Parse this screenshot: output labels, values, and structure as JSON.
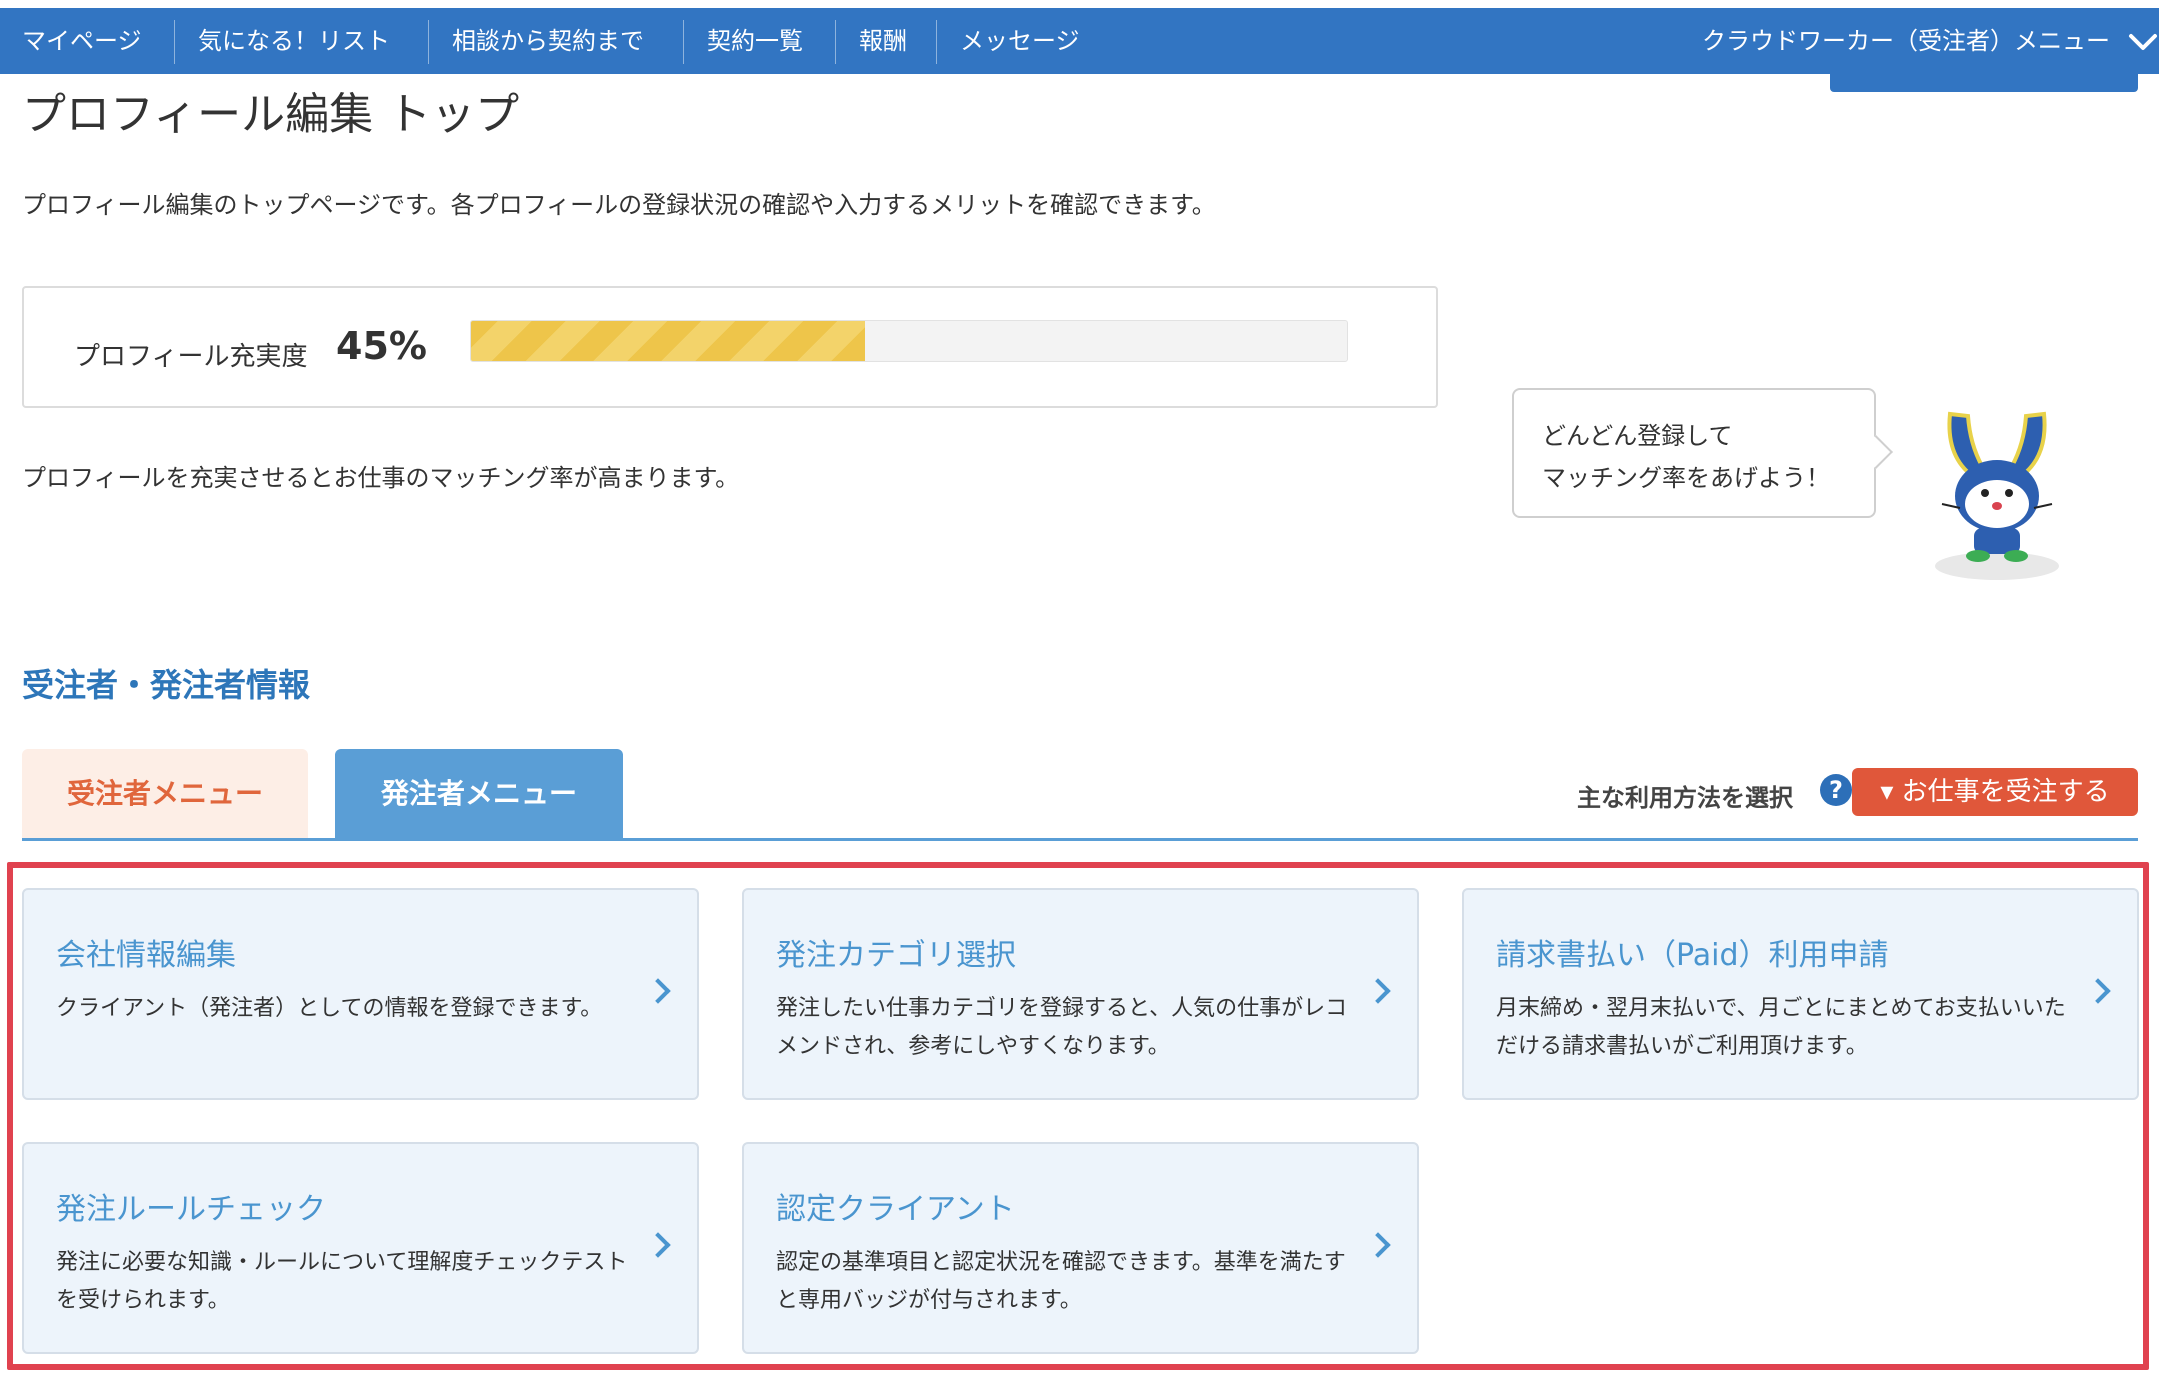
{
  "nav": {
    "items": [
      "マイページ",
      "気になる！リスト",
      "相談から契約まで",
      "契約一覧",
      "報酬",
      "メッセージ"
    ],
    "role_menu": "クラウドワーカー（受注者）メニュー"
  },
  "page": {
    "title": "プロフィール編集 トップ",
    "description": "プロフィール編集のトップページです。各プロフィールの登録状況の確認や入力するメリットを確認できます。"
  },
  "completeness": {
    "label": "プロフィール充実度",
    "value_text": "45%",
    "progress_fraction": 0.45,
    "note": "プロフィールを充実させるとお仕事のマッチング率が高まります。"
  },
  "bubble": {
    "line1": "どんどん登録して",
    "line2": "マッチング率をあげよう！"
  },
  "section": {
    "title": "受注者・発注者情報"
  },
  "tabs": {
    "contractor": "受注者メニュー",
    "client": "発注者メニュー",
    "active": "client"
  },
  "usage": {
    "label": "主な利用方法を選択",
    "help": "?",
    "button": "▾ お仕事を受注する"
  },
  "cards": [
    {
      "title": "会社情報編集",
      "desc": "クライアント（発注者）としての情報を登録できます。"
    },
    {
      "title": "発注カテゴリ選択",
      "desc": "発注したい仕事カテゴリを登録すると、人気の仕事がレコメンドされ、参考にしやすくなります。"
    },
    {
      "title": "請求書払い（Paid）利用申請",
      "desc": "月末締め・翌月末払いで、月ごとにまとめてお支払いいただける請求書払いがご利用頂けます。"
    },
    {
      "title": "発注ルールチェック",
      "desc": "発注に必要な知識・ルールについて理解度チェックテストを受けられます。"
    },
    {
      "title": "認定クライアント",
      "desc": "認定の基準項目と認定状況を確認できます。基準を満たすと専用バッジが付与されます。"
    }
  ],
  "colors": {
    "nav_bg": "#3275c2",
    "accent_blue": "#5a9ed6",
    "accent_orange": "#e0573a",
    "highlight_red": "#e0424f",
    "progress_yellow": "#eec54a"
  }
}
